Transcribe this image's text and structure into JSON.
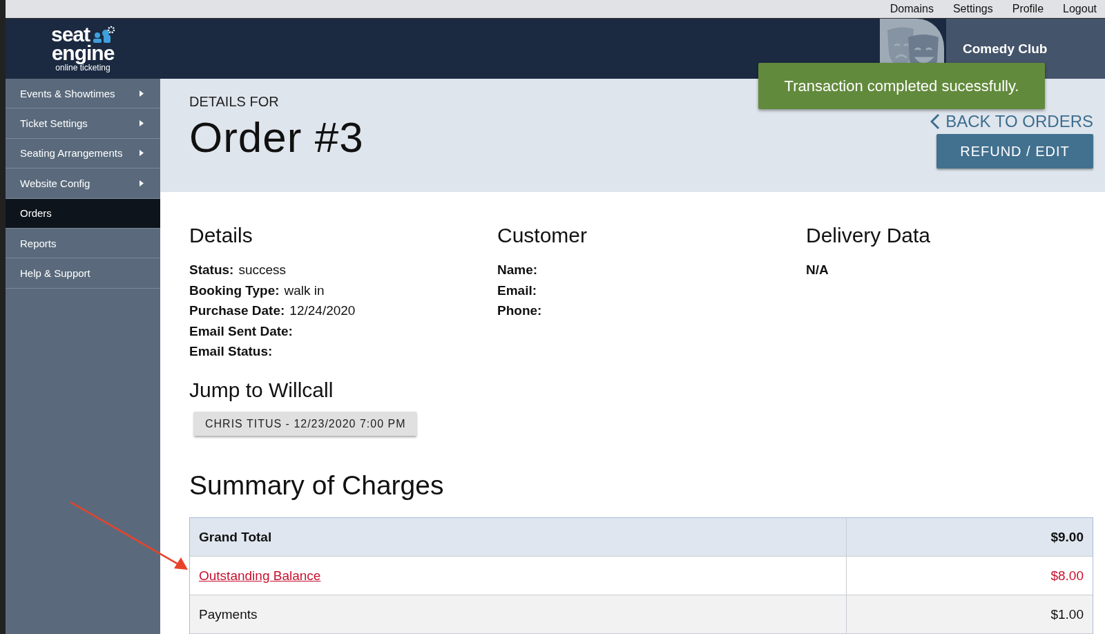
{
  "top_nav": [
    {
      "label": "Domains"
    },
    {
      "label": "Settings"
    },
    {
      "label": "Profile"
    },
    {
      "label": "Logout"
    }
  ],
  "logo": {
    "word1": "seat",
    "word2": "engine",
    "tagline": "online ticketing"
  },
  "venue": {
    "name": "Comedy Club"
  },
  "toast": {
    "message": "Transaction completed sucessfully."
  },
  "sidebar": {
    "items": [
      {
        "label": "Events & Showtimes",
        "submenu": true,
        "selected": false
      },
      {
        "label": "Ticket Settings",
        "submenu": true,
        "selected": false
      },
      {
        "label": "Seating Arrangements",
        "submenu": true,
        "selected": false
      },
      {
        "label": "Website Config",
        "submenu": true,
        "selected": false
      },
      {
        "label": "Orders",
        "submenu": false,
        "selected": true
      },
      {
        "label": "Reports",
        "submenu": false,
        "selected": false
      },
      {
        "label": "Help & Support",
        "submenu": false,
        "selected": false
      }
    ]
  },
  "header": {
    "eyebrow": "DETAILS FOR",
    "title": "Order #3",
    "back_link": "BACK TO ORDERS",
    "action_button": "REFUND / EDIT"
  },
  "sections": [
    {
      "title": "Details",
      "fields": [
        {
          "label": "Status:",
          "value": "success"
        },
        {
          "label": "Booking Type:",
          "value": "walk in"
        },
        {
          "label": "Purchase Date:",
          "value": "12/24/2020"
        },
        {
          "label": "Email Sent Date:"
        },
        {
          "label": "Email Status:"
        }
      ]
    },
    {
      "title": "Customer",
      "fields": [
        {
          "label": "Name:"
        },
        {
          "label": "Email:"
        },
        {
          "label": "Phone:"
        }
      ]
    },
    {
      "title": "Delivery Data",
      "fields": [
        {
          "label": "N/A"
        }
      ]
    }
  ],
  "willcall": {
    "title": "Jump to Willcall",
    "buttons": [
      "CHRIS TITUS - 12/23/2020 7:00 PM"
    ]
  },
  "summary": {
    "title": "Summary of Charges",
    "rows": [
      {
        "kind": "total",
        "label": "Grand Total",
        "amount": "$9.00"
      },
      {
        "kind": "alert",
        "label": "Outstanding Balance",
        "amount": "$8.00"
      },
      {
        "kind": "plain",
        "label": "Payments",
        "amount": "$1.00"
      }
    ]
  }
}
